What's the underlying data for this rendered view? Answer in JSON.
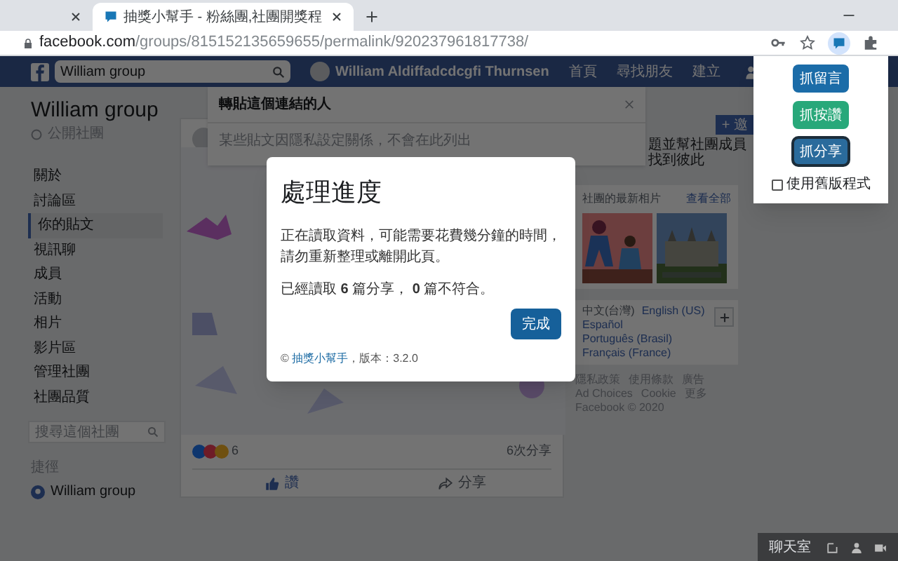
{
  "browser": {
    "tabs": [
      {
        "selected": false
      },
      {
        "title": "抽獎小幫手 - 粉絲團,社團開獎程",
        "selected": true
      }
    ],
    "address": {
      "host": "facebook.com",
      "path": "/groups/815152135659655/permalink/920237961817738/"
    }
  },
  "extension_popup": {
    "buttons": [
      {
        "label": "抓留言",
        "color": "#1b6ca8",
        "selected": false
      },
      {
        "label": "抓按讚",
        "color": "#28a87a",
        "selected": false
      },
      {
        "label": "抓分享",
        "color": "#2a6b9c",
        "selected": true
      }
    ],
    "legacy_option": {
      "label": "使用舊版程式",
      "checked": false
    }
  },
  "header": {
    "search_value": "William group",
    "user_name": "William Aldiffadcdcgfi Thurnsen",
    "nav": [
      "首頁",
      "尋找朋友",
      "建立"
    ]
  },
  "sidebar": {
    "group_name": "William group",
    "group_type": "公開社團",
    "items": [
      {
        "label": "關於",
        "selected": false
      },
      {
        "label": "討論區",
        "selected": false
      },
      {
        "label": "你的貼文",
        "selected": true
      },
      {
        "label": "視訊聊",
        "selected": false
      },
      {
        "label": "成員",
        "selected": false
      },
      {
        "label": "活動",
        "selected": false
      },
      {
        "label": "相片",
        "selected": false
      },
      {
        "label": "影片區",
        "selected": false
      },
      {
        "label": "管理社團",
        "selected": false
      },
      {
        "label": "社團品質",
        "selected": false
      }
    ],
    "search_placeholder": "搜尋這個社團",
    "shortcuts_heading": "捷徑",
    "shortcuts": [
      "William group"
    ]
  },
  "share_dialog": {
    "title": "轉貼這個連結的人",
    "note": "某些貼文因隱私設定關係，不會在此列出"
  },
  "post": {
    "reaction_count": "6",
    "share_count": "6次分享",
    "actions": [
      "讚",
      "分享"
    ]
  },
  "right_column": {
    "invite_button": "+ 邀",
    "about_text": "題並幫社團成員找到彼此",
    "photos": {
      "heading": "社團的最新相片",
      "see_all": "查看全部"
    },
    "languages": [
      "中文(台灣)",
      "English (US)",
      "Español",
      "Português (Brasil)",
      "Français (France)"
    ],
    "footer_links": [
      "隱私政策",
      "使用條款",
      "廣告",
      "Ad Choices",
      "Cookie",
      "更多"
    ],
    "copyright": "Facebook © 2020"
  },
  "chat": {
    "label": "聊天室"
  },
  "progress_modal": {
    "title": "處理進度",
    "message": "正在讀取資料，可能需要花費幾分鐘的時間，請勿重新整理或離開此頁。",
    "progress": "已經讀取 **6** 篇分享， **0** 篇不符合。",
    "done_button": "完成",
    "footer": {
      "prefix": "©",
      "link": "抽獎小幫手",
      "suffix": "，版本：3.2.0"
    }
  }
}
